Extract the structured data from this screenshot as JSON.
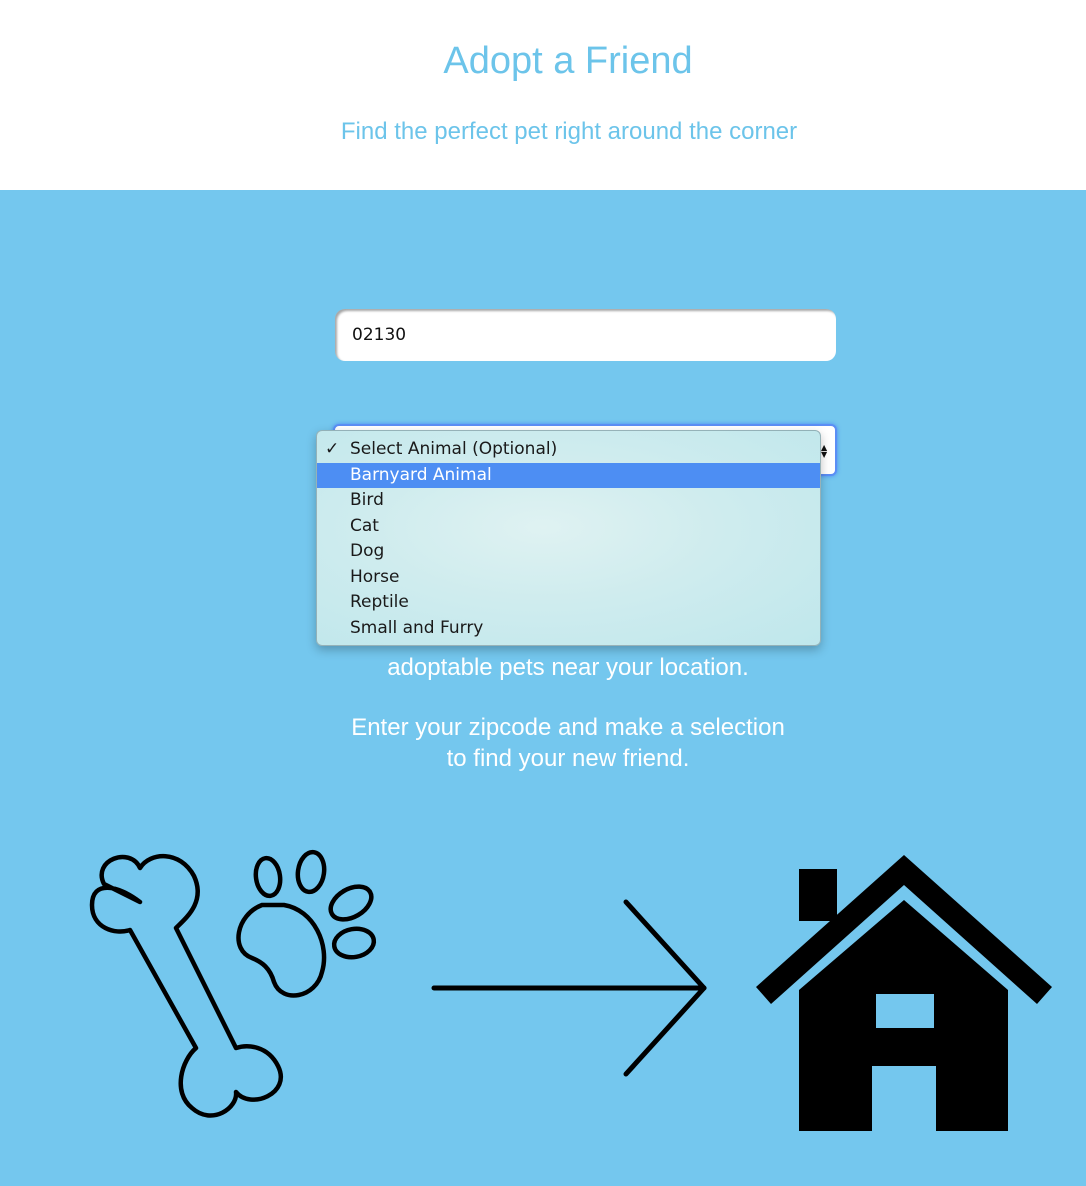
{
  "header": {
    "title": "Adopt a Friend",
    "subtitle": "Find the perfect pet right around the corner"
  },
  "search": {
    "zipcode_value": "02130"
  },
  "animal_select": {
    "selected": "Select Animal (Optional)",
    "highlighted": "Barnyard Animal",
    "options": [
      "Select Animal (Optional)",
      "Barnyard Animal",
      "Bird",
      "Cat",
      "Dog",
      "Horse",
      "Reptile",
      "Small and Furry"
    ]
  },
  "info": {
    "line_partial": "adoptable pets near your location.",
    "instruction_line1": "Enter your zipcode and make a selection",
    "instruction_line2": "to find your new friend."
  },
  "illustration": {
    "icons": [
      "bone-icon",
      "paw-icon",
      "arrow-right-icon",
      "house-icon"
    ]
  },
  "colors": {
    "brand": "#6cc4ea",
    "background": "#74c7ee",
    "highlight": "#4d8ef3"
  }
}
